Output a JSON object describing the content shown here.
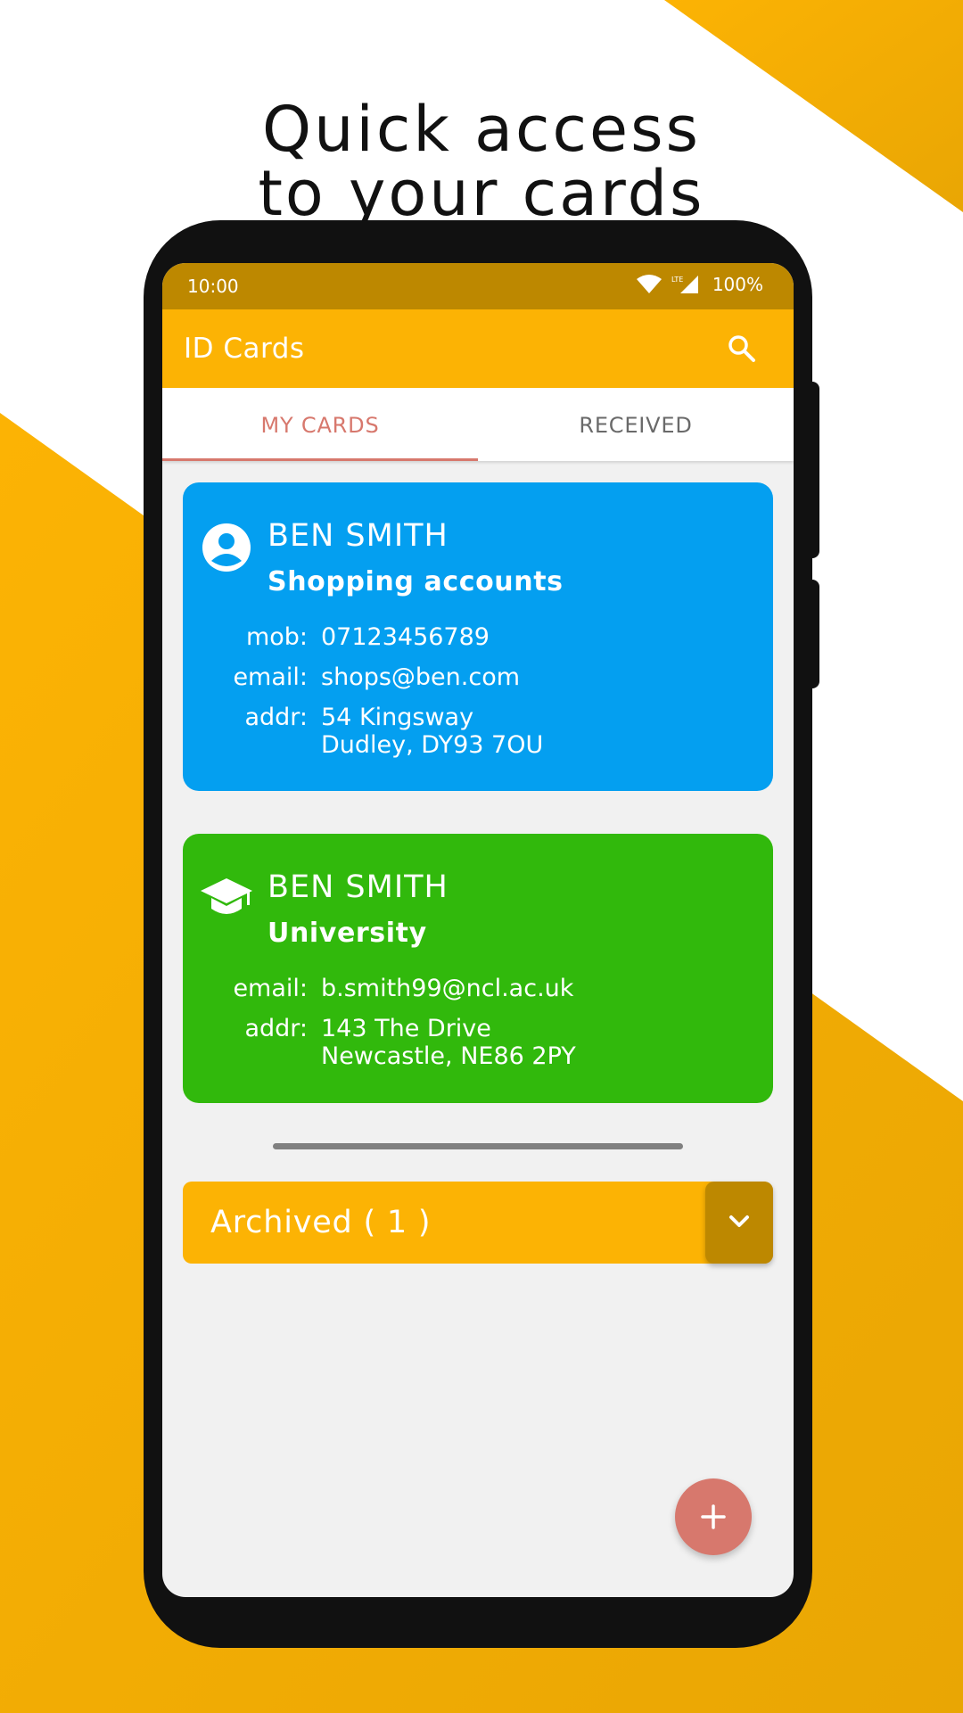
{
  "headline": {
    "line1": "Quick access",
    "line2": "to your cards"
  },
  "status_bar": {
    "time": "10:00",
    "network": "LTE",
    "battery": "100%"
  },
  "app_bar": {
    "title": "ID Cards",
    "search_icon": "search-icon"
  },
  "tabs": [
    {
      "label": "MY CARDS",
      "selected": true
    },
    {
      "label": "RECEIVED",
      "selected": false
    }
  ],
  "cards": [
    {
      "icon": "account-circle-icon",
      "color": "#049ff0",
      "name": "BEN SMITH",
      "label": "Shopping accounts",
      "fields": [
        {
          "key": "mob:",
          "value": "07123456789"
        },
        {
          "key": "email:",
          "value": "shops@ben.com"
        },
        {
          "key": "addr:",
          "line1": "54 Kingsway",
          "line2": "Dudley, DY93 7OU"
        }
      ]
    },
    {
      "icon": "graduation-cap-icon",
      "color": "#31b90c",
      "name": "BEN SMITH",
      "label": "University",
      "fields": [
        {
          "key": "email:",
          "value": "b.smith99@ncl.ac.uk"
        },
        {
          "key": "addr:",
          "line1": "143 The Drive",
          "line2": "Newcastle, NE86 2PY"
        }
      ]
    }
  ],
  "archived": {
    "label": "Archived ( 1 )",
    "icon": "chevron-down-icon"
  },
  "fab": {
    "icon": "plus-icon"
  },
  "colors": {
    "accent": "#fcb304",
    "accent_dark": "#bd8800",
    "tab_active": "#d7786d"
  }
}
